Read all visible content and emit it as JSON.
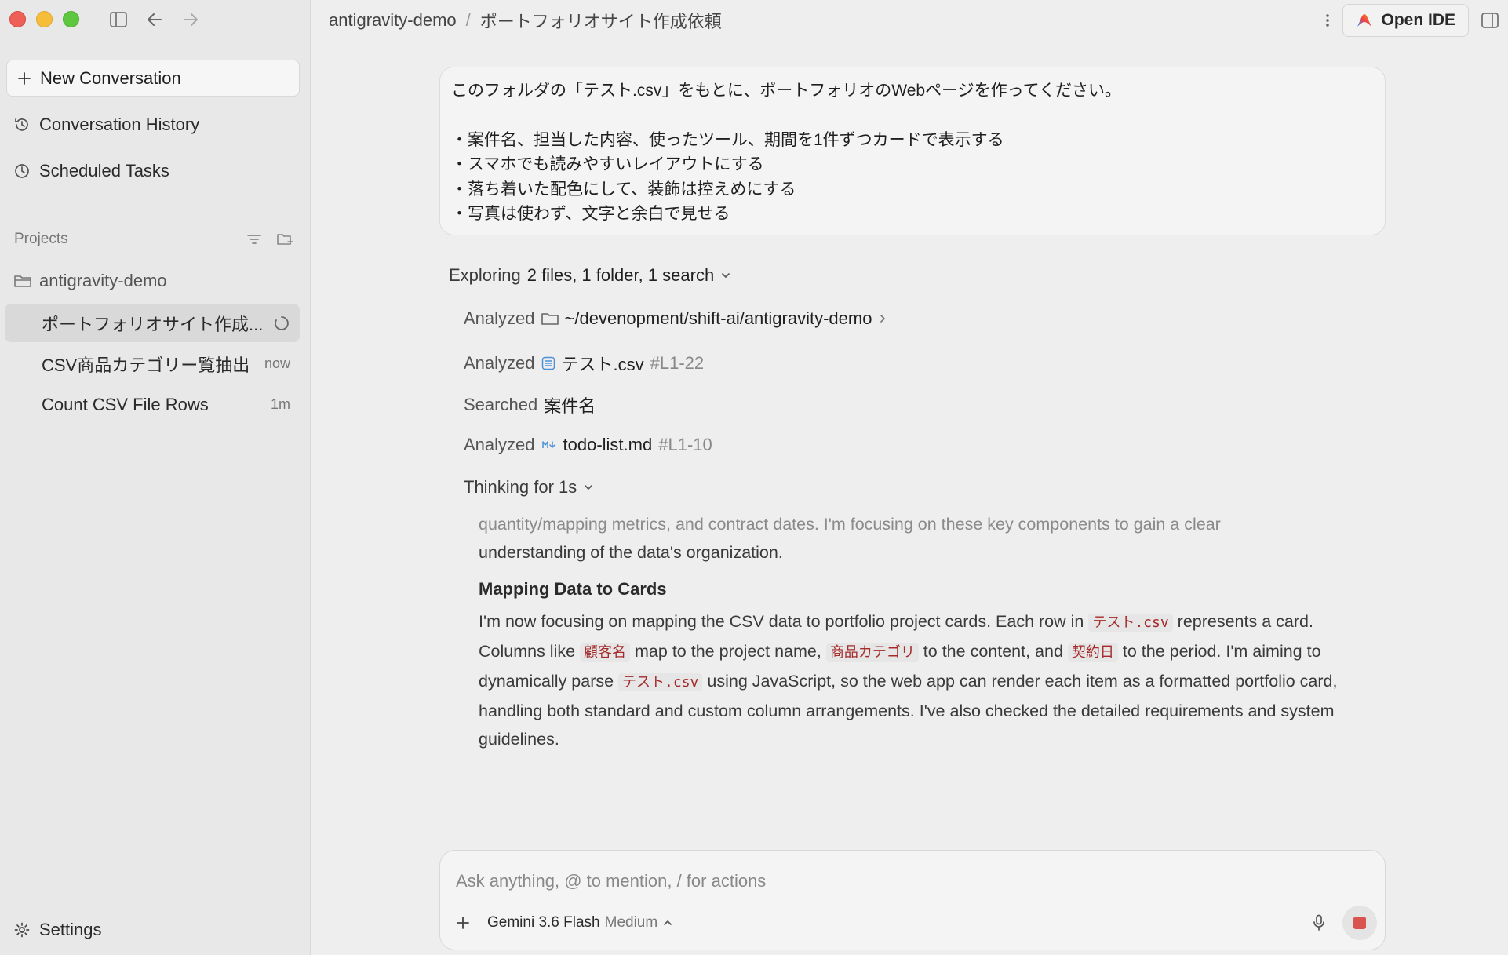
{
  "sidebar": {
    "new_conversation": "New Conversation",
    "nav": [
      {
        "label": "Conversation History",
        "icon": "history-icon"
      },
      {
        "label": "Scheduled Tasks",
        "icon": "clock-icon"
      }
    ],
    "projects_label": "Projects",
    "project_root": "antigravity-demo",
    "conversations": [
      {
        "label": "ポートフォリオサイト作成...",
        "meta": "",
        "active": true
      },
      {
        "label": "CSV商品カテゴリー覧抽出",
        "meta": "now",
        "active": false
      },
      {
        "label": "Count CSV File Rows",
        "meta": "1m",
        "active": false
      }
    ],
    "settings": "Settings"
  },
  "topbar": {
    "crumb_project": "antigravity-demo",
    "crumb_sep": "/",
    "crumb_title": "ポートフォリオサイト作成依頼",
    "open_ide": "Open IDE"
  },
  "user_message": {
    "lines": [
      "このフォルダの「テスト.csv」をもとに、ポートフォリオのWebページを作ってください。",
      "",
      "・案件名、担当した内容、使ったツール、期間を1件ずつカードで表示する",
      "・スマホでも読みやすいレイアウトにする",
      "・落ち着いた配色にして、装飾は控えめにする",
      "・写真は使わず、文字と余白で見せる"
    ]
  },
  "exploring": {
    "prefix": "Exploring",
    "summary": "2 files, 1 folder, 1 search"
  },
  "steps": [
    {
      "verb": "Analyzed",
      "target": "~/devenopment/shift-ai/antigravity-demo",
      "range": "",
      "icon": "folder-icon"
    },
    {
      "verb": "Analyzed",
      "target": "テスト.csv",
      "range": "#L1-22",
      "icon": "table-icon"
    },
    {
      "verb": "Searched",
      "target": "案件名",
      "range": "",
      "icon": ""
    },
    {
      "verb": "Analyzed",
      "target": "todo-list.md",
      "range": "#L1-10",
      "icon": "markdown-icon"
    }
  ],
  "thinking": {
    "label": "Thinking for 1s",
    "faded_line": "quantity/mapping metrics, and contract dates. I'm focusing on these key components to gain a clear",
    "line2": "understanding of the data's organization.",
    "heading": "Mapping Data to Cards",
    "p1": "I'm now focusing on mapping the CSV data to portfolio project cards. Each row in ",
    "c1": "テスト.csv",
    "p2": " represents a card. Columns like ",
    "c2": "顧客名",
    "p3": " map to the project name, ",
    "c3": "商品カテゴリ",
    "p4": " to the content, and ",
    "c4": "契約日",
    "p5": " to the period. I'm aiming to dynamically parse ",
    "c5": "テスト.csv",
    "p6": " using JavaScript, so the web app can render each item as a formatted portfolio card, handling both standard and custom column arrangements. I've also checked the detailed requirements and system guidelines."
  },
  "composer": {
    "placeholder": "Ask anything, @ to mention, / for actions",
    "model": "Gemini 3.6 Flash",
    "level": "Medium"
  },
  "colors": {
    "code_text": "#a52a2a",
    "stop": "#d9534f"
  }
}
